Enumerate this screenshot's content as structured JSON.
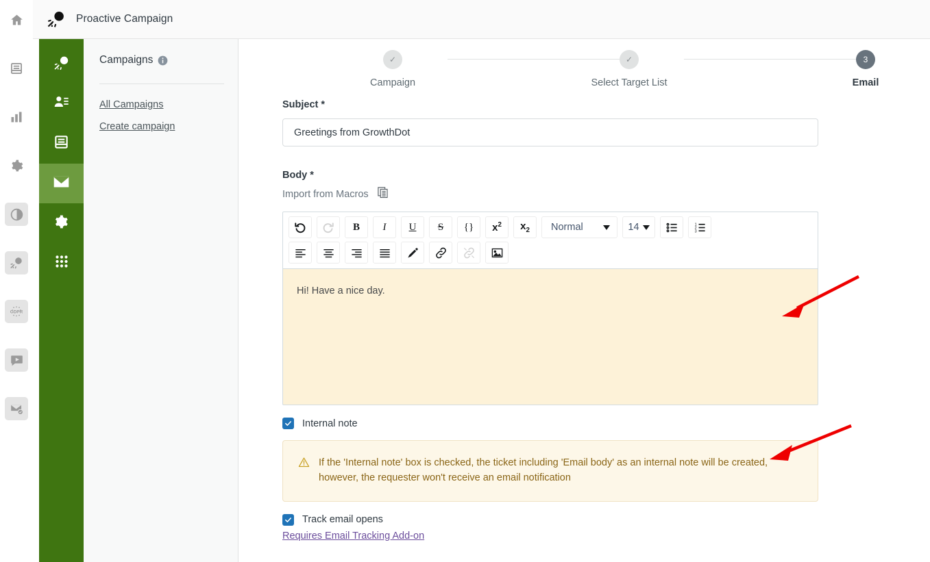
{
  "header": {
    "title": "Proactive Campaign",
    "logo_icon": "comet-icon"
  },
  "rail": {
    "items": [
      {
        "icon": "home-icon",
        "boxed": false
      },
      {
        "icon": "archive-icon",
        "boxed": false
      },
      {
        "icon": "bar-chart-icon",
        "boxed": false
      },
      {
        "icon": "gear-icon",
        "boxed": false
      },
      {
        "icon": "pie-circle-icon",
        "boxed": true
      },
      {
        "icon": "comet-icon",
        "boxed": true
      },
      {
        "icon": "gdpr-icon",
        "boxed": true
      },
      {
        "icon": "video-chat-icon",
        "boxed": true
      },
      {
        "icon": "mail-check-icon",
        "boxed": true
      }
    ]
  },
  "green_nav": {
    "items": [
      {
        "icon": "comet-icon",
        "active": false
      },
      {
        "icon": "person-list-icon",
        "active": false
      },
      {
        "icon": "archive-icon",
        "active": false
      },
      {
        "icon": "mail-icon",
        "active": true
      },
      {
        "icon": "gear-icon",
        "active": false
      },
      {
        "icon": "grid-dots-icon",
        "active": false
      }
    ]
  },
  "panel": {
    "title": "Campaigns",
    "info_icon": "info-icon",
    "links": [
      {
        "label": "All Campaigns"
      },
      {
        "label": "Create campaign"
      }
    ]
  },
  "stepper": {
    "steps": [
      {
        "label": "Campaign",
        "marker": "✓",
        "state": "done"
      },
      {
        "label": "Select Target List",
        "marker": "✓",
        "state": "done"
      },
      {
        "label": "Email",
        "marker": "3",
        "state": "current"
      }
    ]
  },
  "form": {
    "subject_label": "Subject *",
    "subject_value": "Greetings from GrowthDot",
    "subject_placeholder": "Subject",
    "body_label": "Body *",
    "macros_label": "Import from Macros",
    "macros_icon": "copy-document-icon",
    "body_value": "Hi! Have a nice day.",
    "internal_note_label": "Internal note",
    "internal_note_checked": true,
    "warning_icon": "warning-triangle-icon",
    "warning_text": "If the 'Internal note' box is checked, the ticket including 'Email body' as an internal note will be created, however, the requester won't receive an email notification",
    "track_opens_label": "Track email opens",
    "track_opens_checked": true,
    "tracking_link": "Requires Email Tracking Add-on"
  },
  "editor": {
    "toolbar_row1": [
      {
        "name": "undo-button",
        "glyph": "↺",
        "style": "plain",
        "disabled": false
      },
      {
        "name": "redo-button",
        "glyph": "↻",
        "style": "plain",
        "disabled": true
      },
      {
        "name": "bold-button",
        "glyph": "B",
        "style": "bold",
        "disabled": false
      },
      {
        "name": "italic-button",
        "glyph": "I",
        "style": "italic",
        "disabled": false
      },
      {
        "name": "underline-button",
        "glyph": "U",
        "style": "under",
        "disabled": false
      },
      {
        "name": "strikethrough-button",
        "glyph": "S",
        "style": "strike",
        "disabled": false
      },
      {
        "name": "code-button",
        "glyph": "{}",
        "style": "plain",
        "disabled": false
      },
      {
        "name": "superscript-button",
        "glyph": "x",
        "style": "sup",
        "disabled": false
      },
      {
        "name": "subscript-button",
        "glyph": "x",
        "style": "sub",
        "disabled": false
      }
    ],
    "format_select": "Normal",
    "size_select": "14",
    "colors": {
      "body_background": "#fdf2d8",
      "warning_background": "#fdf7e8",
      "warning_text": "#8a6516",
      "checkbox": "#1f73b7",
      "green_nav": "#3f7511",
      "green_nav_active": "#6d9b3f",
      "annotation_arrow": "#ee0000"
    }
  },
  "annotations": [
    {
      "name": "arrow-to-body-editor"
    },
    {
      "name": "arrow-to-warning-box"
    }
  ]
}
